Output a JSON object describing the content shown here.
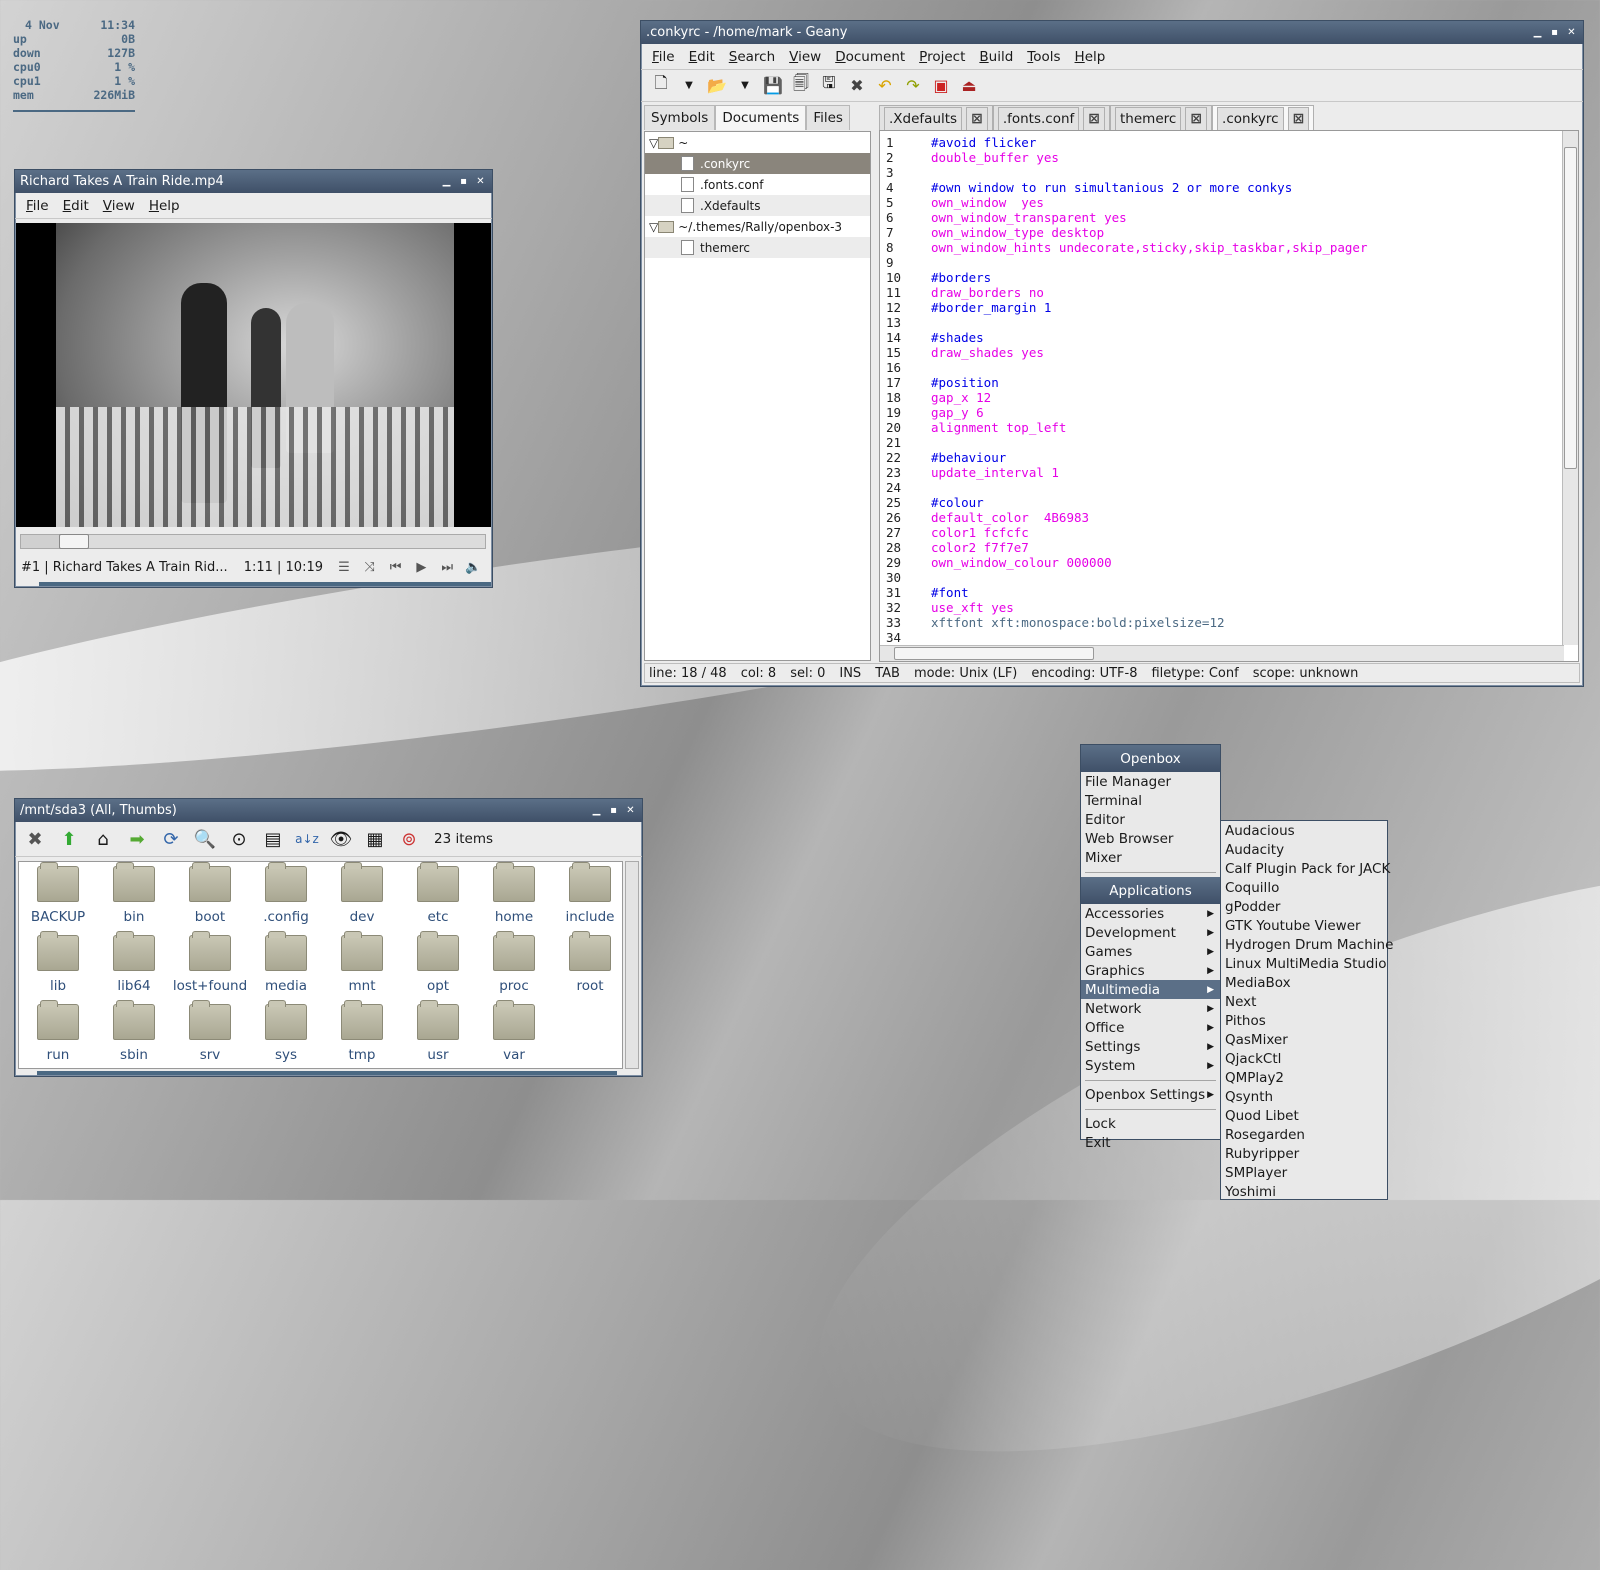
{
  "conky": {
    "date": "4 Nov",
    "time": "11:34",
    "rows": [
      {
        "label": "up",
        "value": "0B"
      },
      {
        "label": "down",
        "value": "127B"
      },
      {
        "label": "cpu0",
        "value": "1 %"
      },
      {
        "label": "cpu1",
        "value": "1 %"
      },
      {
        "label": "mem",
        "value": "226MiB"
      }
    ],
    "color": "#4B6983"
  },
  "video_player": {
    "title": "Richard Takes A Train Ride.mp4",
    "menu": [
      "File",
      "Edit",
      "View",
      "Help"
    ],
    "track": "#1 | Richard Takes A Train Rid...",
    "time": "1:11 | 10:19",
    "progress": 0.115,
    "controls": [
      "playlist-icon",
      "shuffle-icon",
      "previous-icon",
      "play-icon",
      "next-icon",
      "volume-icon"
    ]
  },
  "geany": {
    "title": ".conkyrc - /home/mark - Geany",
    "menu": [
      "File",
      "Edit",
      "Search",
      "View",
      "Document",
      "Project",
      "Build",
      "Tools",
      "Help"
    ],
    "sidebar_tabs": [
      "Symbols",
      "Documents",
      "Files"
    ],
    "tree": [
      {
        "label": "~",
        "type": "dir",
        "indent": 0
      },
      {
        "label": ".conkyrc",
        "type": "file",
        "indent": 1,
        "selected": true
      },
      {
        "label": ".fonts.conf",
        "type": "file",
        "indent": 1
      },
      {
        "label": ".Xdefaults",
        "type": "file",
        "indent": 1
      },
      {
        "label": "~/.themes/Rally/openbox-3",
        "type": "dir",
        "indent": 0
      },
      {
        "label": "themerc",
        "type": "file",
        "indent": 1
      }
    ],
    "tabs": [
      ".Xdefaults",
      ".fonts.conf",
      "themerc",
      ".conkyrc"
    ],
    "active_tab": ".conkyrc",
    "lines": [
      {
        "n": "1",
        "t": "#avoid flicker",
        "s": "c"
      },
      {
        "n": "2",
        "t": "double_buffer yes",
        "s": "k"
      },
      {
        "n": "3",
        "t": "",
        "s": "k"
      },
      {
        "n": "4",
        "t": "#own window to run simultanious 2 or more conkys",
        "s": "c"
      },
      {
        "n": "5",
        "t": "own_window  yes",
        "s": "k"
      },
      {
        "n": "6",
        "t": "own_window_transparent yes",
        "s": "k"
      },
      {
        "n": "7",
        "t": "own_window_type desktop",
        "s": "k"
      },
      {
        "n": "8",
        "t": "own_window_hints undecorate,sticky,skip_taskbar,skip_pager",
        "s": "k"
      },
      {
        "n": "9",
        "t": "",
        "s": "k"
      },
      {
        "n": "10",
        "t": "#borders",
        "s": "c"
      },
      {
        "n": "11",
        "t": "draw_borders no",
        "s": "k"
      },
      {
        "n": "12",
        "t": "#border_margin 1",
        "s": "c"
      },
      {
        "n": "13",
        "t": "",
        "s": "k"
      },
      {
        "n": "14",
        "t": "#shades",
        "s": "c"
      },
      {
        "n": "15",
        "t": "draw_shades yes",
        "s": "k"
      },
      {
        "n": "16",
        "t": "",
        "s": "k"
      },
      {
        "n": "17",
        "t": "#position",
        "s": "c"
      },
      {
        "n": "18",
        "t": "gap_x 12",
        "s": "k"
      },
      {
        "n": "19",
        "t": "gap_y 6",
        "s": "k"
      },
      {
        "n": "20",
        "t": "alignment top_left",
        "s": "k"
      },
      {
        "n": "21",
        "t": "",
        "s": "k"
      },
      {
        "n": "22",
        "t": "#behaviour",
        "s": "c"
      },
      {
        "n": "23",
        "t": "update_interval 1",
        "s": "k"
      },
      {
        "n": "24",
        "t": "",
        "s": "k"
      },
      {
        "n": "25",
        "t": "#colour",
        "s": "c"
      },
      {
        "n": "26",
        "t": "default_color  4B6983",
        "s": "k"
      },
      {
        "n": "27",
        "t": "color1 fcfcfc",
        "s": "k"
      },
      {
        "n": "28",
        "t": "color2 f7f7e7",
        "s": "k"
      },
      {
        "n": "29",
        "t": "own_window_colour 000000",
        "s": "k"
      },
      {
        "n": "30",
        "t": "",
        "s": "k"
      },
      {
        "n": "31",
        "t": "#font",
        "s": "c"
      },
      {
        "n": "32",
        "t": "use_xft yes",
        "s": "k"
      },
      {
        "n": "33",
        "t": "xftfont xft:monospace:bold:pixelsize=12",
        "s": "n"
      },
      {
        "n": "34",
        "t": "",
        "s": "k"
      }
    ],
    "status": [
      "line: 18 / 48",
      "col: 8",
      "sel: 0",
      "INS",
      "TAB",
      "mode: Unix (LF)",
      "encoding: UTF-8",
      "filetype: Conf",
      "scope: unknown"
    ]
  },
  "file_manager": {
    "title": "/mnt/sda3 (All, Thumbs)",
    "count": "23 items",
    "toolbar": [
      "close-icon",
      "up-icon",
      "home-icon",
      "go-icon",
      "refresh-icon",
      "zoom-in-icon",
      "zoom-fit-icon",
      "list-view-icon",
      "sort-icon",
      "eye-icon",
      "details-icon",
      "help-icon"
    ],
    "items": [
      "BACKUP",
      "bin",
      "boot",
      ".config",
      "dev",
      "etc",
      "home",
      "include",
      "lib",
      "lib64",
      "lost+found",
      "media",
      "mnt",
      "opt",
      "proc",
      "root",
      "run",
      "sbin",
      "srv",
      "sys",
      "tmp",
      "usr",
      "var"
    ]
  },
  "openbox_menu": {
    "header": "Openbox",
    "top": [
      "File Manager",
      "Terminal",
      "Editor",
      "Web Browser",
      "Mixer"
    ],
    "apps_header": "Applications",
    "apps": [
      {
        "label": "Accessories",
        "sub": true
      },
      {
        "label": "Development",
        "sub": true
      },
      {
        "label": "Games",
        "sub": true
      },
      {
        "label": "Graphics",
        "sub": true
      },
      {
        "label": "Multimedia",
        "sub": true,
        "highlighted": true
      },
      {
        "label": "Network",
        "sub": true
      },
      {
        "label": "Office",
        "sub": true
      },
      {
        "label": "Settings",
        "sub": true
      },
      {
        "label": "System",
        "sub": true
      }
    ],
    "settings": "Openbox Settings",
    "bottom": [
      "Lock",
      "Exit"
    ]
  },
  "multimedia_menu": [
    "Audacious",
    "Audacity",
    "Calf Plugin Pack for JACK",
    "Coquillo",
    "gPodder",
    "GTK Youtube Viewer",
    "Hydrogen Drum Machine",
    "Linux MultiMedia Studio",
    "MediaBox",
    "Next",
    "Pithos",
    "QasMixer",
    "QjackCtl",
    "QMPlay2",
    "Qsynth",
    "Quod Libet",
    "Rosegarden",
    "Rubyripper",
    "SMPlayer",
    "Yoshimi"
  ]
}
